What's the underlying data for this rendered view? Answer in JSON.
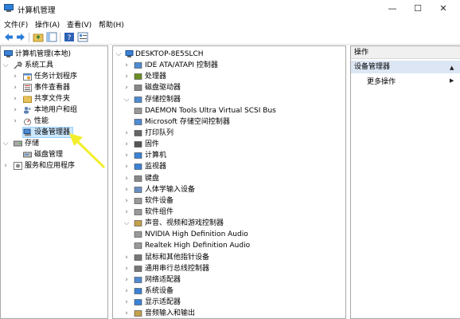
{
  "window": {
    "title": "计算机管理",
    "minimize": "—",
    "maximize": "☐",
    "close": "✕"
  },
  "menu": {
    "file": "文件(F)",
    "action": "操作(A)",
    "view": "查看(V)",
    "help": "帮助(H)"
  },
  "toolbar_icons": [
    "back-icon",
    "forward-icon",
    "up-folder-icon",
    "show-hide-tree-icon",
    "help-icon",
    "properties-icon"
  ],
  "left_tree": {
    "root": "计算机管理(本地)",
    "system_tools": "系统工具",
    "task_scheduler": "任务计划程序",
    "event_viewer": "事件查看器",
    "shared_folders": "共享文件夹",
    "local_users": "本地用户和组",
    "performance": "性能",
    "device_manager": "设备管理器",
    "storage": "存储",
    "disk_management": "磁盘管理",
    "services_apps": "服务和应用程序"
  },
  "device_tree": {
    "computer": "DESKTOP-8E5SLCH",
    "categories": [
      {
        "label": "IDE ATA/ATAPI 控制器",
        "expanded": false,
        "icon": "ide-controller-icon"
      },
      {
        "label": "处理器",
        "expanded": false,
        "icon": "processor-icon"
      },
      {
        "label": "磁盘驱动器",
        "expanded": false,
        "icon": "disk-drive-icon"
      },
      {
        "label": "存储控制器",
        "expanded": true,
        "icon": "storage-controller-icon"
      },
      {
        "label": "DAEMON Tools Ultra Virtual SCSI Bus",
        "child": true,
        "icon": "scsi-icon"
      },
      {
        "label": "Microsoft 存储空间控制器",
        "child": true,
        "icon": "storage-spaces-icon"
      },
      {
        "label": "打印队列",
        "expanded": false,
        "icon": "printer-icon"
      },
      {
        "label": "固件",
        "expanded": false,
        "icon": "firmware-icon"
      },
      {
        "label": "计算机",
        "expanded": false,
        "icon": "computer-icon"
      },
      {
        "label": "监视器",
        "expanded": false,
        "icon": "monitor-icon"
      },
      {
        "label": "键盘",
        "expanded": false,
        "icon": "keyboard-icon"
      },
      {
        "label": "人体学输入设备",
        "expanded": false,
        "icon": "hid-icon"
      },
      {
        "label": "软件设备",
        "expanded": false,
        "icon": "software-device-icon"
      },
      {
        "label": "软件组件",
        "expanded": false,
        "icon": "software-component-icon"
      },
      {
        "label": "声音、视频和游戏控制器",
        "expanded": true,
        "icon": "sound-icon"
      },
      {
        "label": "NVIDIA High Definition Audio",
        "child": true,
        "icon": "speaker-icon"
      },
      {
        "label": "Realtek High Definition Audio",
        "child": true,
        "icon": "speaker-icon"
      },
      {
        "label": "鼠标和其他指针设备",
        "expanded": false,
        "icon": "mouse-icon"
      },
      {
        "label": "通用串行总线控制器",
        "expanded": false,
        "icon": "usb-icon"
      },
      {
        "label": "网络适配器",
        "expanded": false,
        "icon": "network-adapter-icon"
      },
      {
        "label": "系统设备",
        "expanded": false,
        "icon": "system-device-icon"
      },
      {
        "label": "显示适配器",
        "expanded": false,
        "icon": "display-adapter-icon"
      },
      {
        "label": "音频输入和输出",
        "expanded": false,
        "icon": "audio-io-icon"
      }
    ]
  },
  "actions": {
    "header": "操作",
    "section": "设备管理器",
    "more": "更多操作"
  },
  "colors": {
    "selection": "#cce8ff",
    "action_section": "#dce6f4",
    "arrow": "#f2ee2a"
  }
}
